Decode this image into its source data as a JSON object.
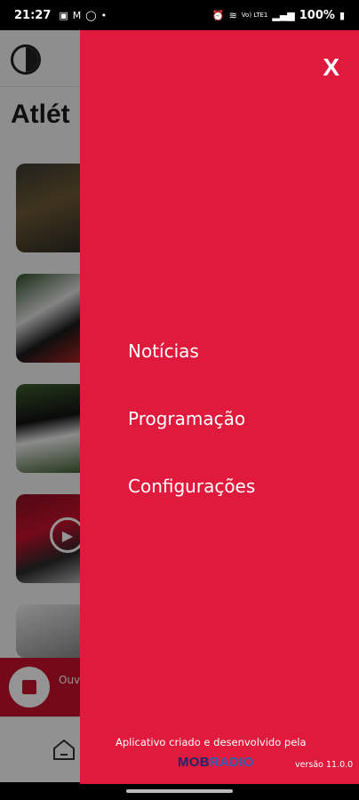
{
  "status_bar": {
    "time": "21:27",
    "left_icons": [
      "image-icon",
      "gmail-icon",
      "whatsapp-icon",
      "dot-icon"
    ],
    "right_icons": [
      "alarm-icon",
      "wifi-icon",
      "volte-icon",
      "signal-icon",
      "battery-icon"
    ],
    "volte_label": "Vo) LTE1",
    "battery": "100%"
  },
  "background_app": {
    "title": "Atlét",
    "player_text": "Ouv",
    "colors": {
      "accent": "#c8102e"
    }
  },
  "drawer": {
    "close_label": "X",
    "menu": [
      {
        "label": "Notícias"
      },
      {
        "label": "Programação"
      },
      {
        "label": "Configurações"
      }
    ],
    "credits": "Aplicativo criado e desenvolvido pela",
    "brand_part1": "MOB",
    "brand_part2": "RADIO",
    "version": "versão 11.0.0",
    "colors": {
      "background": "#e01a3c",
      "text": "#ffffff"
    }
  }
}
